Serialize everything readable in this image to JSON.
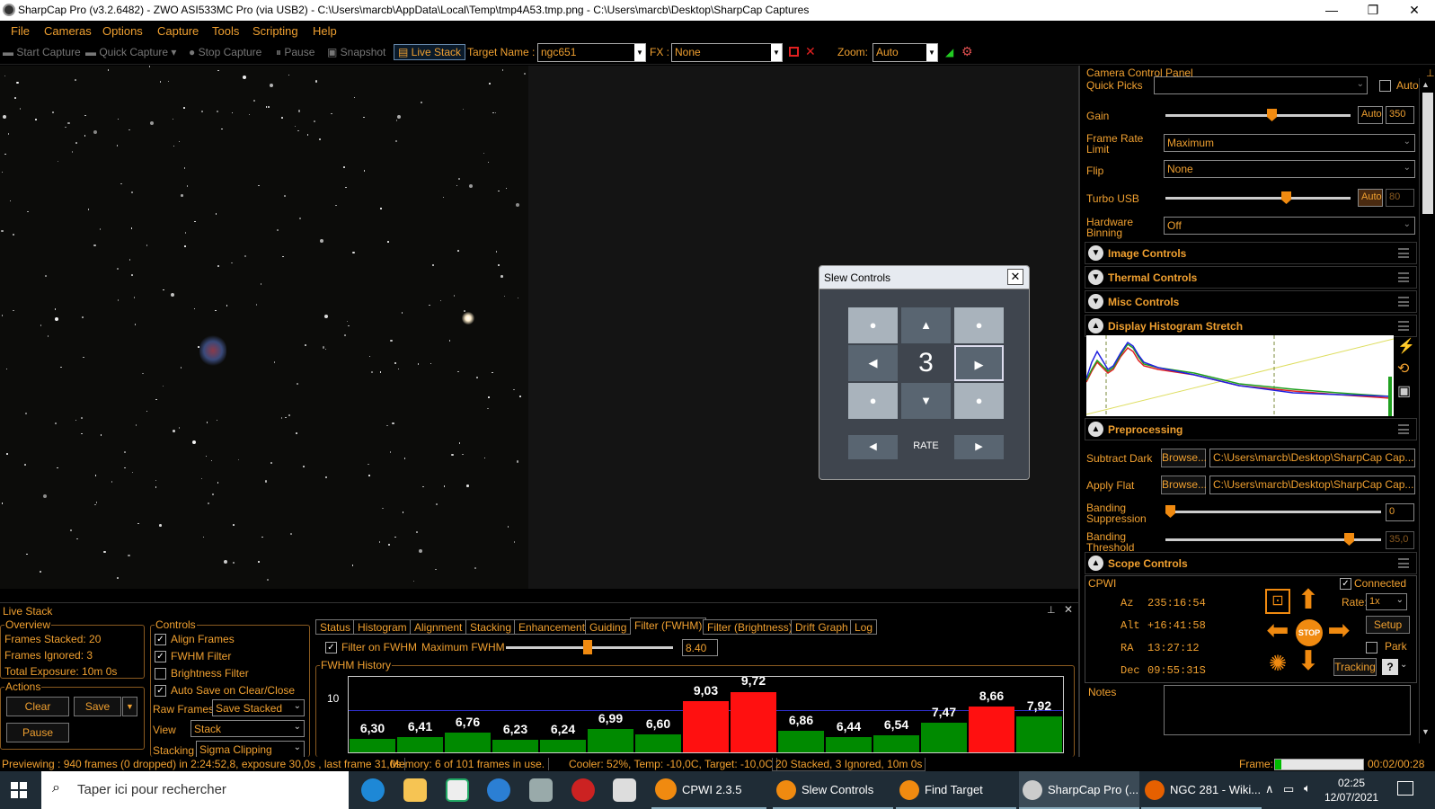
{
  "window": {
    "title": "SharpCap Pro (v3.2.6482) - ZWO ASI533MC Pro (via USB2) - C:\\Users\\marcb\\AppData\\Local\\Temp\\tmp4A53.tmp.png - C:\\Users\\marcb\\Desktop\\SharpCap Captures",
    "minimize": "—",
    "maximize": "❐",
    "close": "✕"
  },
  "menu": [
    "File",
    "Cameras",
    "Options",
    "Capture",
    "Tools",
    "Scripting",
    "Help"
  ],
  "toolbar": {
    "start_capture": "Start Capture",
    "quick_capture": "Quick Capture",
    "stop_capture": "Stop Capture",
    "pause": "Pause",
    "snapshot": "Snapshot",
    "live_stack": "Live Stack",
    "target_name_label": "Target Name :",
    "target_name_value": "ngc651",
    "fx_label": "FX :",
    "fx_value": "None",
    "zoom_label": "Zoom:",
    "zoom_value": "Auto"
  },
  "slew_controls": {
    "title": "Slew Controls",
    "close": "✕",
    "rate_value": "3",
    "rate_label": "RATE",
    "up": "▲",
    "down": "▼",
    "left": "◀",
    "right": "▶",
    "dot": "●"
  },
  "camera_panel": {
    "title": "Camera Control Panel",
    "quick_picks_label": "Quick Picks",
    "auto_label": "Auto",
    "gain_label": "Gain",
    "gain_auto": "Auto",
    "gain_value": "350",
    "gain_level": 0.58,
    "frame_rate_label": "Frame Rate Limit",
    "frame_rate_value": "Maximum",
    "flip_label": "Flip",
    "flip_value": "None",
    "turbo_usb_label": "Turbo USB",
    "turbo_auto": "Auto",
    "turbo_value": "80",
    "turbo_level": 0.66,
    "hw_binning_label": "Hardware Binning",
    "hw_binning_value": "Off",
    "sections": {
      "image_controls": "Image Controls",
      "thermal_controls": "Thermal Controls",
      "misc_controls": "Misc Controls",
      "display_histogram": "Display Histogram Stretch",
      "preprocessing": "Preprocessing",
      "scope_controls": "Scope Controls"
    },
    "preprocessing": {
      "subtract_dark_label": "Subtract Dark",
      "apply_flat_label": "Apply Flat",
      "browse": "Browse...",
      "dark_path": "C:\\Users\\marcb\\Desktop\\SharpCap Cap...",
      "flat_path": "C:\\Users\\marcb\\Desktop\\SharpCap Cap...",
      "banding_suppression_label": "Banding Suppression",
      "banding_suppression_value": "0",
      "banding_suppression_level": 0.0,
      "banding_threshold_label": "Banding Threshold",
      "banding_threshold_value": "35,0",
      "banding_threshold_level": 0.87
    },
    "scope": {
      "mount": "CPWI",
      "connected_label": "Connected",
      "az_label": "Az",
      "az_value": "235:16:54",
      "alt_label": "Alt",
      "alt_value": "+16:41:58",
      "ra_label": "RA",
      "ra_value": "13:27:12",
      "dec_label": "Dec",
      "dec_value": "09:55:31S",
      "rate_label": "Rate:",
      "rate_value": "1x",
      "setup": "Setup",
      "park": "Park",
      "tracking": "Tracking",
      "stop": "STOP",
      "help": "?",
      "notes_label": "Notes"
    }
  },
  "live_stack": {
    "title": "Live Stack",
    "overview_label": "Overview",
    "frames_stacked": "Frames Stacked: 20",
    "frames_ignored": "Frames Ignored:  3",
    "total_exposure": "Total Exposure:   10m 0s",
    "actions_label": "Actions",
    "clear": "Clear",
    "save": "Save",
    "pause": "Pause",
    "controls_label": "Controls",
    "align_frames": "Align Frames",
    "fwhm_filter": "FWHM Filter",
    "brightness_filter": "Brightness Filter",
    "auto_save": "Auto Save on Clear/Close",
    "raw_frames_label": "Raw Frames",
    "raw_frames_value": "Save Stacked",
    "view_label": "View",
    "view_value": "Stack",
    "stacking_label": "Stacking",
    "stacking_value": "Sigma Clipping",
    "tabs": [
      "Status",
      "Histogram",
      "Alignment",
      "Stacking",
      "Enhancement",
      "Guiding",
      "Filter (FWHM)",
      "Filter (Brightness)",
      "Drift Graph",
      "Log"
    ],
    "filter_on_fwhm": "Filter on FWHM",
    "maximum_fwhm_label": "Maximum FWHM",
    "maximum_fwhm_value": "8.40",
    "fwhm_history_label": "FWHM History"
  },
  "chart_data": {
    "type": "bar",
    "title": "FWHM History",
    "y_tick": "10",
    "threshold": 8.4,
    "values": [
      6.3,
      6.41,
      6.76,
      6.23,
      6.24,
      6.99,
      6.6,
      9.03,
      9.72,
      6.86,
      6.44,
      6.54,
      7.47,
      8.66,
      7.92
    ],
    "labels": [
      "6,30",
      "6,41",
      "6,76",
      "6,23",
      "6,24",
      "6,99",
      "6,60",
      "9,03",
      "9,72",
      "6,86",
      "6,44",
      "6,54",
      "7,47",
      "8,66",
      "7,92"
    ],
    "colors": {
      "pass": "#008a00",
      "reject": "#ff1010"
    }
  },
  "status": {
    "previewing": "Previewing : 940 frames (0 dropped) in 2:24:52,8, exposure 30,0s , last frame 31,0s",
    "memory": "Memory: 6 of 101 frames in use.",
    "cooler": "Cooler: 52%, Temp: -10,0C, Target: -10,0C",
    "stacked": "20 Stacked, 3 Ignored, 10m 0s",
    "frame_label": "Frame:",
    "frame_time": "00:02/00:28",
    "frame_progress": 0.07
  },
  "taskbar": {
    "search_placeholder": "Taper ici pour rechercher",
    "apps": [
      "CPWI 2.3.5",
      "Slew Controls",
      "Find Target",
      "SharpCap Pro (...",
      "NGC 281 - Wiki..."
    ],
    "time": "02:25",
    "date": "12/07/2021"
  }
}
